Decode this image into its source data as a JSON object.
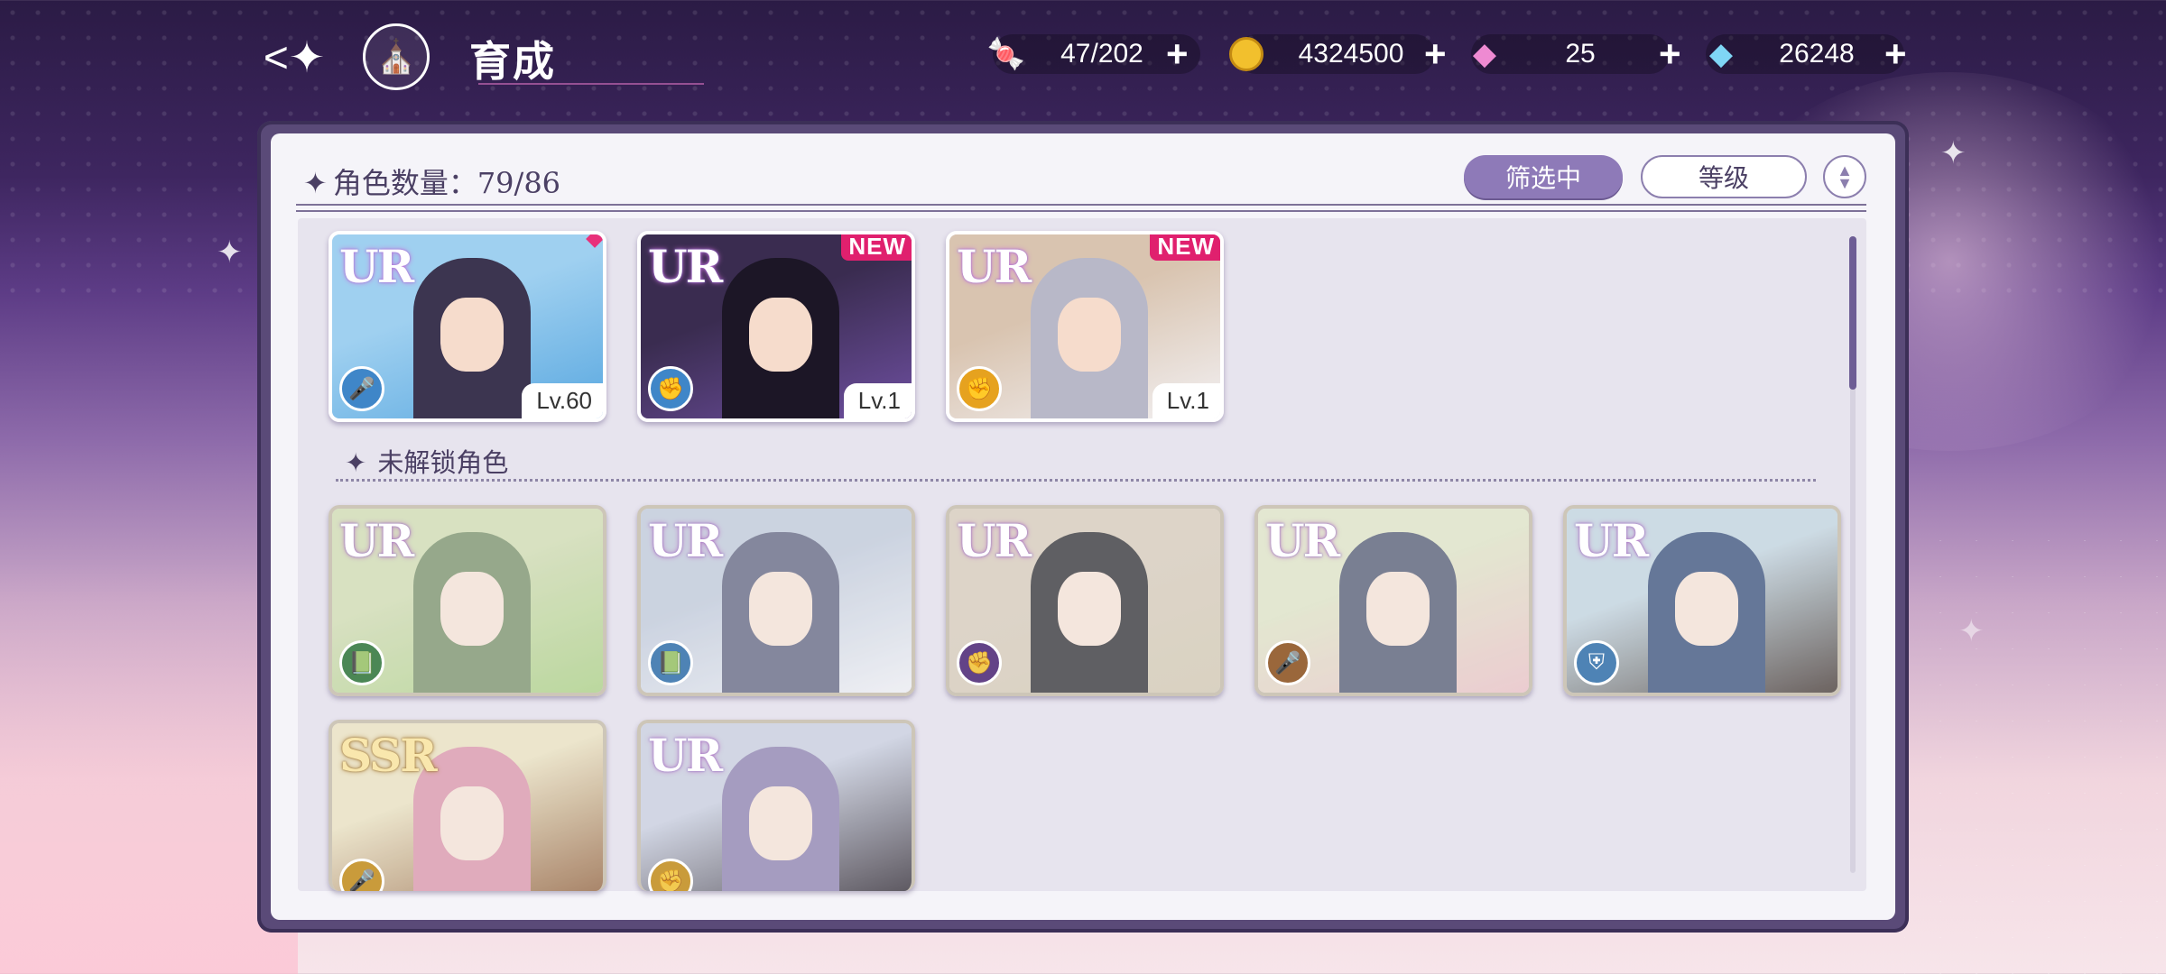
{
  "header": {
    "title": "育成",
    "back_icon": "back-arrow-icon",
    "home_icon": "castle-icon"
  },
  "currencies": [
    {
      "name": "candy",
      "icon": "candy-icon",
      "value": "47/202"
    },
    {
      "name": "coin",
      "icon": "gold-coin-icon",
      "value": "4324500"
    },
    {
      "name": "pink-gem",
      "icon": "pink-diamond-icon",
      "value": "25"
    },
    {
      "name": "blue-gem",
      "icon": "blue-diamond-icon",
      "value": "26248"
    }
  ],
  "panel": {
    "count_label": "角色数量：79/86",
    "filter_label": "筛选中",
    "sort_label": "等级",
    "order_icon": "sort-order-icon",
    "locked_section": "未解锁角色"
  },
  "owned": [
    {
      "rarity": "UR",
      "role_icon": "microphone-icon",
      "role_color": "#3f86c8",
      "level": "Lv.60",
      "badge": "dot",
      "palette": [
        "#9fd0f0",
        "#5aa8e0",
        "#3c3550"
      ]
    },
    {
      "rarity": "UR",
      "role_icon": "fist-icon",
      "role_color": "#3f86c8",
      "level": "Lv.1",
      "badge": "NEW",
      "palette": [
        "#3a2c50",
        "#6e4fa0",
        "#1c1626"
      ]
    },
    {
      "rarity": "UR",
      "role_icon": "fist-icon",
      "role_color": "#e6a21f",
      "level": "Lv.1",
      "badge": "NEW",
      "palette": [
        "#d9c4b0",
        "#f2f0f2",
        "#b8b8c8"
      ]
    }
  ],
  "locked": [
    {
      "rarity": "UR",
      "role_icon": "book-icon",
      "role_color": "#3d8c4a",
      "palette": [
        "#c8d8a0",
        "#9ccf6a",
        "#6e8e5a"
      ]
    },
    {
      "rarity": "UR",
      "role_icon": "book-icon",
      "role_color": "#3f86c8",
      "palette": [
        "#b7c4dc",
        "#e8eaf2",
        "#5a5f86"
      ]
    },
    {
      "rarity": "UR",
      "role_icon": "fist-icon",
      "role_color": "#6a3f9a",
      "palette": [
        "#d6c6b0",
        "#cfc3a6",
        "#2a2a30"
      ]
    },
    {
      "rarity": "UR",
      "role_icon": "microphone-icon",
      "role_color": "#a8642a",
      "palette": [
        "#d9e0b8",
        "#f0b8c0",
        "#4a5476"
      ]
    },
    {
      "rarity": "UR",
      "role_icon": "shield-icon",
      "role_color": "#3f86c8",
      "palette": [
        "#b6d0e0",
        "#3e2e28",
        "#2b4a86"
      ]
    },
    {
      "rarity": "SSR",
      "role_icon": "microphone-icon",
      "role_color": "#d89a1a",
      "palette": [
        "#e8dcb0",
        "#9a5a2a",
        "#e88aa8"
      ]
    },
    {
      "rarity": "UR",
      "role_icon": "fist-icon",
      "role_color": "#d89a1a",
      "palette": [
        "#c0c8e0",
        "#2a2230",
        "#8a7ab8"
      ]
    }
  ]
}
